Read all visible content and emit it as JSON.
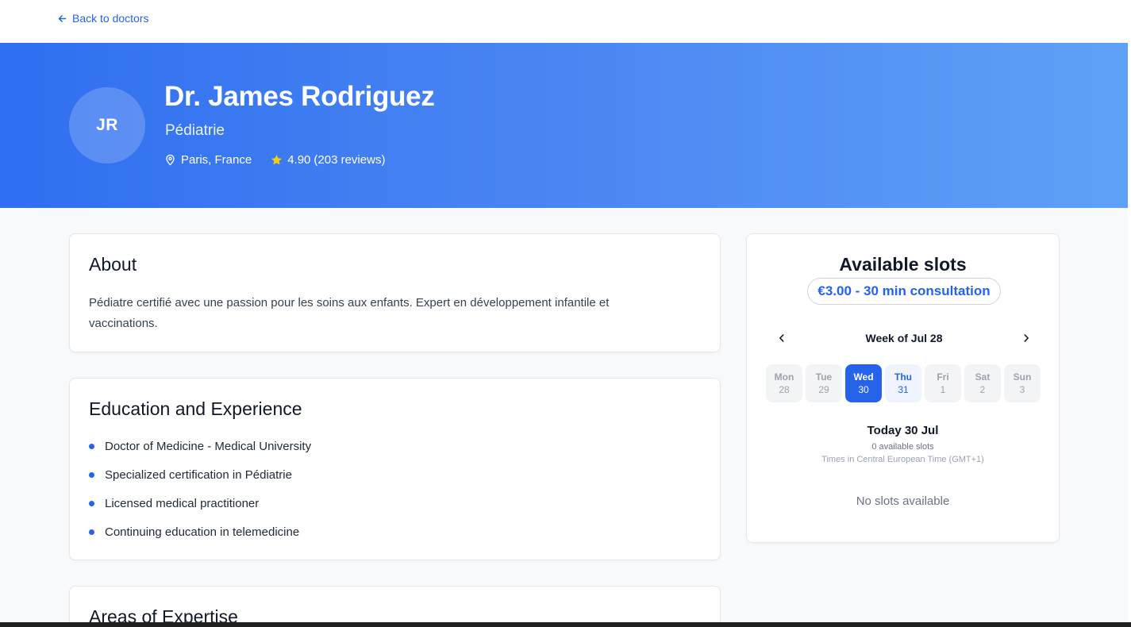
{
  "nav": {
    "back_label": "Back to doctors",
    "back_icon": "arrow-left-icon"
  },
  "doctor": {
    "initials": "JR",
    "name": "Dr. James Rodriguez",
    "specialty": "Pédiatrie",
    "location": "Paris, France",
    "rating": "4.90",
    "reviews": "(203 reviews)"
  },
  "about": {
    "title": "About",
    "text": "Pédiatre certifié avec une passion pour les soins aux enfants. Expert en développement infantile et vaccinations."
  },
  "education": {
    "title": "Education and Experience",
    "items": [
      "Doctor of Medicine - Medical University",
      "Specialized certification in Pédiatrie",
      "Licensed medical practitioner",
      "Continuing education in telemedicine"
    ]
  },
  "expertise": {
    "title": "Areas of Expertise"
  },
  "booking": {
    "title": "Available slots",
    "price": "€3.00 - 30 min consultation",
    "week_label": "Week of Jul 28",
    "days": [
      {
        "name": "Mon",
        "date": "28",
        "state": "past"
      },
      {
        "name": "Tue",
        "date": "29",
        "state": "past"
      },
      {
        "name": "Wed",
        "date": "30",
        "state": "selected"
      },
      {
        "name": "Thu",
        "date": "31",
        "state": "available"
      },
      {
        "name": "Fri",
        "date": "1",
        "state": "disabled"
      },
      {
        "name": "Sat",
        "date": "2",
        "state": "disabled"
      },
      {
        "name": "Sun",
        "date": "3",
        "state": "disabled"
      }
    ],
    "selected_day_label": "Today 30 Jul",
    "slot_count": "0 available slots",
    "timezone_note": "Times in Central European Time (GMT+1)",
    "empty_message": "No slots available"
  },
  "colors": {
    "accent": "#2563eb",
    "hero_gradient_start": "#2f6ff0",
    "hero_gradient_end": "#5ea1f7",
    "star": "#facc15"
  }
}
